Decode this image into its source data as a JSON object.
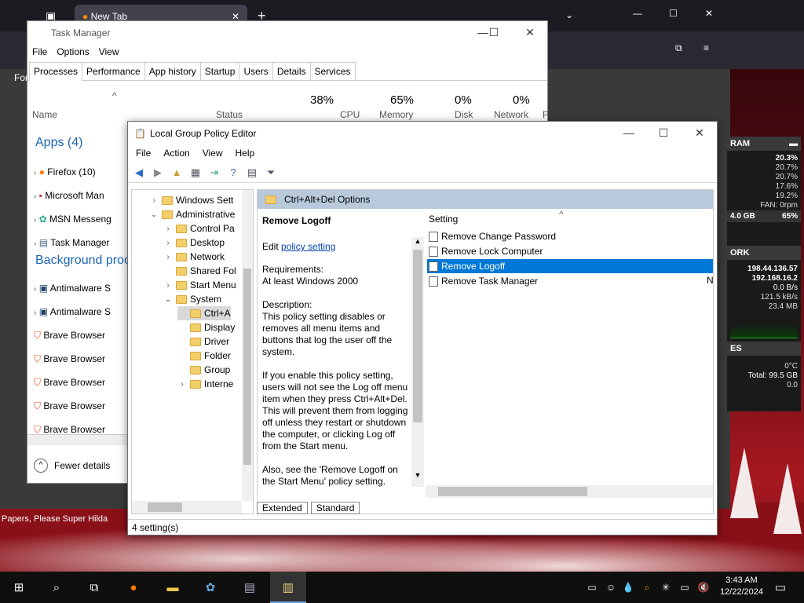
{
  "browser": {
    "tab_title": "New Tab",
    "partial_label": "For"
  },
  "taskmanager": {
    "title": "Task Manager",
    "menu": [
      "File",
      "Options",
      "View"
    ],
    "tabs": [
      "Processes",
      "Performance",
      "App history",
      "Startup",
      "Users",
      "Details",
      "Services"
    ],
    "columns": {
      "name": "Name",
      "status": "Status",
      "cpu_pct": "38%",
      "cpu": "CPU",
      "mem_pct": "65%",
      "mem": "Memory",
      "disk_pct": "0%",
      "disk": "Disk",
      "net_pct": "0%",
      "net": "Network",
      "p": "P"
    },
    "apps_header": "Apps (4)",
    "apps": [
      "Firefox (10)",
      "Microsoft Man",
      "MSN Messeng",
      "Task Manager"
    ],
    "bg_header": "Background proc",
    "bg": [
      "Antimalware S",
      "Antimalware S",
      "Brave Browser",
      "Brave Browser",
      "Brave Browser",
      "Brave Browser",
      "Brave Browser"
    ],
    "fewer": "Fewer details"
  },
  "gpe": {
    "title": "Local Group Policy Editor",
    "menu": [
      "File",
      "Action",
      "View",
      "Help"
    ],
    "tree": [
      {
        "label": "Windows Sett",
        "indent": 1,
        "chev": ">"
      },
      {
        "label": "Administrative",
        "indent": 1,
        "chev": "v"
      },
      {
        "label": "Control Pa",
        "indent": 2,
        "chev": ">"
      },
      {
        "label": "Desktop",
        "indent": 2,
        "chev": ">"
      },
      {
        "label": "Network",
        "indent": 2,
        "chev": ">"
      },
      {
        "label": "Shared Fol",
        "indent": 2,
        "chev": ""
      },
      {
        "label": "Start Menu",
        "indent": 2,
        "chev": ">"
      },
      {
        "label": "System",
        "indent": 2,
        "chev": "v"
      },
      {
        "label": "Ctrl+A",
        "indent": 3,
        "chev": ""
      },
      {
        "label": "Display",
        "indent": 3,
        "chev": ""
      },
      {
        "label": "Driver",
        "indent": 3,
        "chev": ""
      },
      {
        "label": "Folder",
        "indent": 3,
        "chev": ""
      },
      {
        "label": "Group",
        "indent": 3,
        "chev": ""
      },
      {
        "label": "Interne",
        "indent": 3,
        "chev": ">"
      }
    ],
    "folder_header": "Ctrl+Alt+Del Options",
    "policy_title": "Remove Logoff",
    "edit_prefix": "Edit",
    "edit_link": "policy setting",
    "requirements_label": "Requirements:",
    "requirements": "At least Windows 2000",
    "description_label": "Description:",
    "description": "This policy setting disables or removes all menu items and buttons that log the user off the system.",
    "description2": "If you enable this policy setting, users will not see the Log off menu item when they press Ctrl+Alt+Del. This will prevent them from logging off unless they restart or shutdown the computer, or clicking Log off from the Start menu.",
    "description3": "Also, see the 'Remove Logoff on the Start Menu' policy setting.",
    "setting_header": "Setting",
    "settings": [
      "Remove Change Password",
      "Remove Lock Computer",
      "Remove Logoff",
      "Remove Task Manager"
    ],
    "settings_extra": "N",
    "view_tabs": [
      "Extended",
      "Standard"
    ],
    "status": "4 setting(s)"
  },
  "widget": {
    "ram": "RAM",
    "r1": "20.3%",
    "r2": "20.7%",
    "r3": "20.7%",
    "r4": "17.6%",
    "r5": "19.2%",
    "fan": "FAN: 0rpm",
    "mem_gb": "4.0 GB",
    "mem_pct": "65%",
    "network": "ORK",
    "ip1": "198.44.136.57",
    "ip2": "192.168.16.2",
    "n1": "0.0 B/s",
    "n2": "121.5 kB/s",
    "n3": "23.4 MB",
    "drives": "ES",
    "temp": "0°C",
    "total": "Total: 99.5 GB",
    "dz": "0.0"
  },
  "desktop_text": "Papers, Please   Super Hilda",
  "clock": {
    "time": "3:43 AM",
    "date": "12/22/2024"
  }
}
